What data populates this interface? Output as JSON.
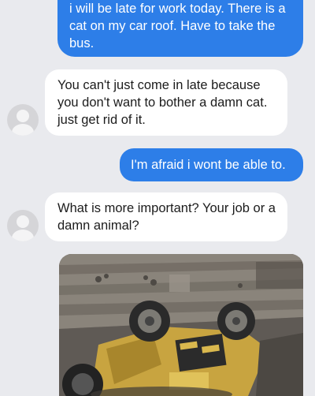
{
  "conversation": {
    "messages": [
      {
        "sender": "me",
        "text": "i will be late for work today. There is a cat on my car roof. Have to take the bus."
      },
      {
        "sender": "other",
        "text": "You can't just come in late because you don't want to bother a damn cat. just get rid of it."
      },
      {
        "sender": "me",
        "text": "I'm afraid i wont be able to."
      },
      {
        "sender": "other",
        "text": "What is more important? Your job or a damn animal?"
      }
    ],
    "attachment": {
      "kind": "photo"
    }
  },
  "colors": {
    "background": "#e9eaee",
    "outgoing_bubble": "#2d7ee8",
    "incoming_bubble": "#ffffff",
    "avatar": "#d5d5d8"
  },
  "icons": {
    "avatar": "person-silhouette-icon"
  }
}
